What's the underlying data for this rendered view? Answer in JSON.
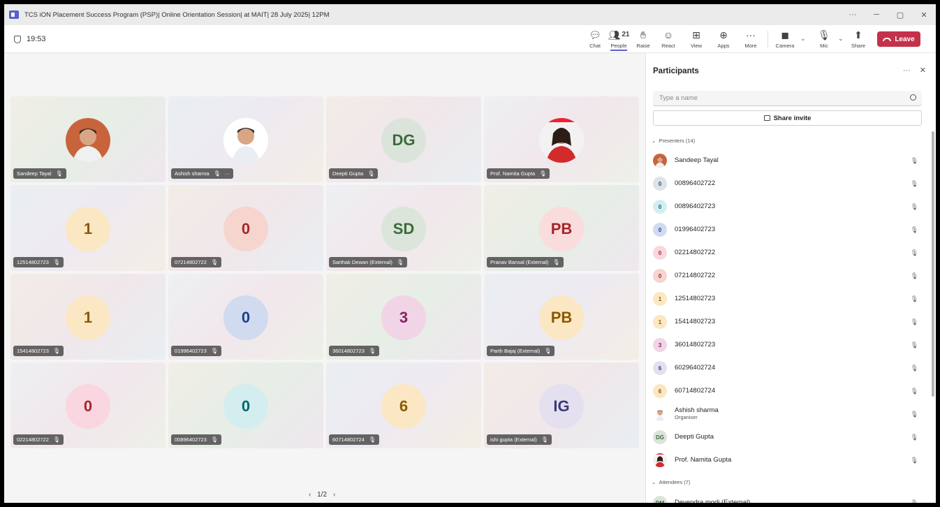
{
  "window": {
    "title": "TCS iON Placement Success Program (PSP)| Online Orientation Session| at MAIT| 28 July 2025| 12PM"
  },
  "toolbar": {
    "timer": "19:53",
    "people_count": "21",
    "labels": {
      "chat": "Chat",
      "people": "People",
      "raise": "Raise",
      "react": "React",
      "view": "View",
      "apps": "Apps",
      "more": "More",
      "camera": "Camera",
      "mic": "Mic",
      "share": "Share",
      "leave": "Leave"
    }
  },
  "stage": {
    "tiles": [
      {
        "name": "Sandeep Tayal",
        "avatar": "photo"
      },
      {
        "name": "Ashish sharma",
        "avatar": "photo",
        "more": "···"
      },
      {
        "name": "Deepti Gupta",
        "initials": "DG",
        "color": "#dbe4da",
        "text_color": "#3b6b3c"
      },
      {
        "name": "Prof. Namita Gupta",
        "avatar": "photo"
      },
      {
        "name": "12514802723",
        "initials": "1",
        "color": "#fbe7c3",
        "text_color": "#8a5a00"
      },
      {
        "name": "07214802722",
        "initials": "0",
        "color": "#f5d5ce",
        "text_color": "#a4262c"
      },
      {
        "name": "Sarthak Dewan (External)",
        "initials": "SD",
        "color": "#dce5d9",
        "text_color": "#3b6b3c"
      },
      {
        "name": "Pranav Bansal (External)",
        "initials": "PB",
        "color": "#fbdcdc",
        "text_color": "#a4262c"
      },
      {
        "name": "15414802723",
        "initials": "1",
        "color": "#fbe7c3",
        "text_color": "#8a5a00"
      },
      {
        "name": "01996402723",
        "initials": "0",
        "color": "#d0dbef",
        "text_color": "#1d3f8a"
      },
      {
        "name": "36014802723",
        "initials": "3",
        "color": "#f1d4e6",
        "text_color": "#8a2163"
      },
      {
        "name": "Parth Bajaj (External)",
        "initials": "PB",
        "color": "#fbe7c3",
        "text_color": "#8a5a00"
      },
      {
        "name": "02214802722",
        "initials": "0",
        "color": "#f9d6e0",
        "text_color": "#a4262c"
      },
      {
        "name": "00896402723",
        "initials": "0",
        "color": "#d4eef0",
        "text_color": "#00666d"
      },
      {
        "name": "60714802724",
        "initials": "6",
        "color": "#fbe7c3",
        "text_color": "#8a5a00"
      },
      {
        "name": "ishi gupta (External)",
        "initials": "IG",
        "color": "#e4e0f0",
        "text_color": "#3d3a7a"
      }
    ],
    "pager": "1/2"
  },
  "panel": {
    "title": "Participants",
    "search_placeholder": "Type a name",
    "share_invite": "Share invite",
    "presenters_label": "Presenters (14)",
    "attendees_label": "Attendees (7)",
    "presenters": [
      {
        "name": "Sandeep Tayal",
        "avatar": "photo"
      },
      {
        "name": "00896402722",
        "initials": "0",
        "color": "#dce3ea",
        "text_color": "#3a4a5a"
      },
      {
        "name": "00896402723",
        "initials": "0",
        "color": "#d4eef0",
        "text_color": "#00666d"
      },
      {
        "name": "01996402723",
        "initials": "0",
        "color": "#d0dbef",
        "text_color": "#1d3f8a"
      },
      {
        "name": "02214802722",
        "initials": "0",
        "color": "#f9d6e0",
        "text_color": "#a4262c"
      },
      {
        "name": "07214802722",
        "initials": "0",
        "color": "#f5d5ce",
        "text_color": "#a4262c"
      },
      {
        "name": "12514802723",
        "initials": "1",
        "color": "#fbe7c3",
        "text_color": "#8a5a00"
      },
      {
        "name": "15414802723",
        "initials": "1",
        "color": "#fbe7c3",
        "text_color": "#8a5a00"
      },
      {
        "name": "36014802723",
        "initials": "3",
        "color": "#f1d4e6",
        "text_color": "#8a2163"
      },
      {
        "name": "60296402724",
        "initials": "6",
        "color": "#e4e0f0",
        "text_color": "#3d3a7a"
      },
      {
        "name": "60714802724",
        "initials": "6",
        "color": "#fbe7c3",
        "text_color": "#8a5a00"
      },
      {
        "name": "Ashish sharma",
        "role": "Organiser",
        "avatar": "photo"
      },
      {
        "name": "Deepti Gupta",
        "initials": "DG",
        "color": "#dbe4da",
        "text_color": "#3b6b3c"
      },
      {
        "name": "Prof. Namita Gupta",
        "avatar": "photo"
      }
    ],
    "attendees": [
      {
        "name": "Devendra modi (External)",
        "initials": "DM",
        "color": "#dbe4da",
        "text_color": "#3b6b3c"
      }
    ]
  }
}
